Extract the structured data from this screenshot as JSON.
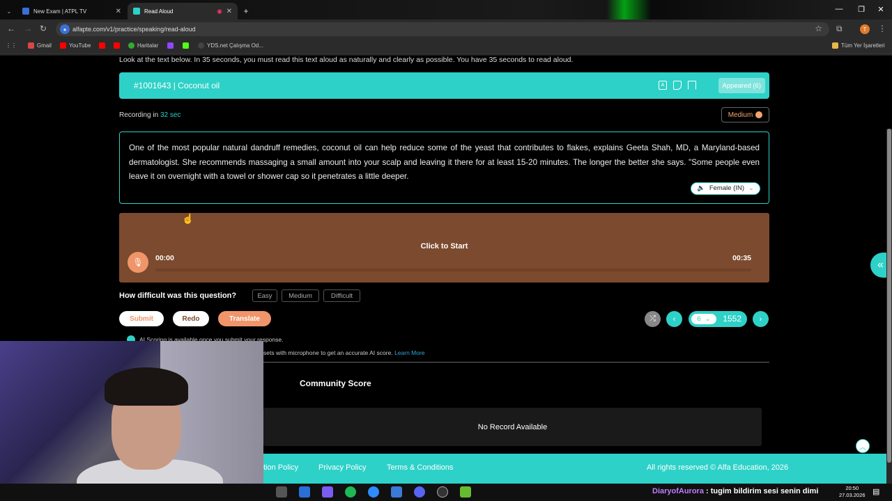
{
  "browser": {
    "tabs": [
      {
        "title": "New Exam | ATPL TV",
        "active": false
      },
      {
        "title": "Read Aloud",
        "active": true
      }
    ],
    "url": "alfapte.com/v1/practice/speaking/read-aloud",
    "bookmarks": [
      "Gmail",
      "YouTube",
      "Haritalar",
      "YDS.net Çalışma Od...",
      "Tüm Yer İşaretleri"
    ]
  },
  "page": {
    "instructions": "Look at the text below. In 35 seconds, you must read this text aloud as naturally and clearly as possible. You have 35 seconds to read aloud.",
    "question_title": "#1001643 | Coconut oil",
    "appeared": "Appeared (6)",
    "recording_label": "Recording in",
    "recording_seconds": "32 sec",
    "difficulty_badge": "Medium",
    "passage": "One of the most popular natural dandruff remedies, coconut oil can help reduce some of the yeast that contributes to flakes, explains Geeta Shah, MD, a Maryland-based dermatologist. She recommends massaging a small amount into your scalp and leaving it there for at least 15-20 minutes. The longer the better she says. \"Some people even leave it on overnight with a towel or shower cap so it penetrates a little deeper.",
    "voice": "Female (IN)",
    "recorder": {
      "prompt": "Click to Start",
      "elapsed": "00:00",
      "total": "00:35",
      "progress": 0
    },
    "difficulty_question": "How difficult was this question?",
    "difficulty_options": [
      "Easy",
      "Medium",
      "Difficult"
    ],
    "actions": {
      "submit": "Submit",
      "redo": "Redo",
      "translate": "Translate"
    },
    "pager": {
      "current": "6",
      "total": "1552"
    },
    "ai_note": "AI Scoring is available once you submit your response.",
    "ai_note2_prefix": "sets with microphone to get an accurate AI score.",
    "learn_more": "Learn More",
    "community_title": "Community Score",
    "no_record": "No Record Available",
    "footer": {
      "refund": "tion Policy",
      "privacy": "Privacy Policy",
      "terms": "Terms & Conditions",
      "rights": "All rights reserved © Alfa Education, 2026"
    }
  },
  "taskbar": {
    "ticker_user": "DiaryofAurora",
    "ticker_text": ": tugim bildirim sesi senin dimi",
    "time": "20:50",
    "date": "27.03.2026"
  },
  "colors": {
    "accent": "#2ed1c7",
    "recorder_bg": "#7c4a2e",
    "mic": "#f0956a",
    "medium": "#f3a46e"
  }
}
